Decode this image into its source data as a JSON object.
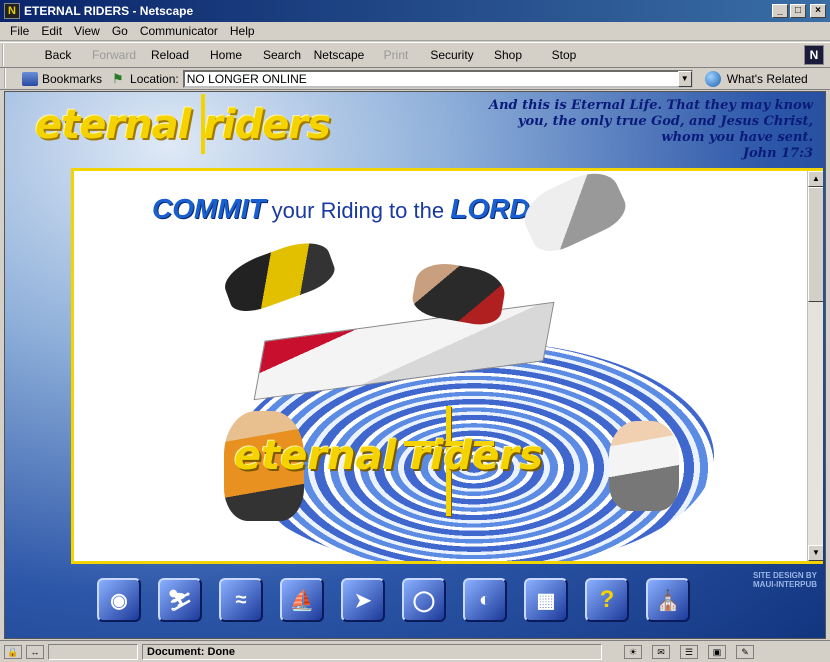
{
  "window": {
    "title": "ETERNAL RIDERS - Netscape",
    "app_icon": "N",
    "min": "_",
    "max": "□",
    "close": "×"
  },
  "menu": [
    {
      "label": "File"
    },
    {
      "label": "Edit"
    },
    {
      "label": "View"
    },
    {
      "label": "Go"
    },
    {
      "label": "Communicator"
    },
    {
      "label": "Help"
    }
  ],
  "nav": {
    "back": "Back",
    "forward": "Forward",
    "reload": "Reload",
    "home": "Home",
    "search": "Search",
    "netscape": "Netscape",
    "print": "Print",
    "security": "Security",
    "shop": "Shop",
    "stop": "Stop",
    "logo": "N"
  },
  "location": {
    "bookmarks_label": "Bookmarks",
    "location_label": "Location:",
    "url_value": "NO LONGER ONLINE",
    "whats_related": "What's Related"
  },
  "page": {
    "logo_text": "eternal riders",
    "verse_lines": [
      "And this is Eternal Life. That they may know",
      "you, the only true God, and Jesus Christ,",
      "whom you have sent."
    ],
    "verse_ref": "John 17:3",
    "commit_big": "COMMIT",
    "commit_rest": "your Riding to the",
    "commit_lord": "LORD",
    "frame_logo": "eternal riders",
    "credit_line1": "SITE DESIGN BY",
    "credit_line2": "MAUI-INTERPUB",
    "nav_icons": [
      "eye-icon",
      "skier-icon",
      "surfer-icon",
      "windsurfer-icon",
      "jetski-icon",
      "biker-icon",
      "globe-icon",
      "map-icon",
      "help-icon",
      "church-icon"
    ],
    "help_glyph": "?"
  },
  "status": {
    "text": "Document: Done"
  },
  "colors": {
    "title_bar": "#0a246a",
    "accent_yellow": "#f5d300",
    "verse_blue": "#0a1a7a",
    "page_blue": "#2c56a8"
  }
}
